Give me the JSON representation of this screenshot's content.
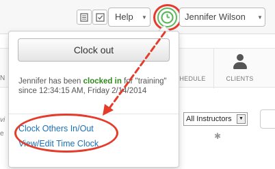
{
  "header": {
    "help_label": "Help",
    "user_name": "Jennifer Wilson"
  },
  "background": {
    "nav_items": [
      {
        "label": "HEDULE"
      },
      {
        "label": "CLIENTS"
      }
    ],
    "left_fragments": [
      "N",
      "vi",
      "e"
    ],
    "instructor_select_value": "All Instructors"
  },
  "dropdown": {
    "clock_out_label": "Clock out",
    "status": {
      "prefix": "Jennifer has been ",
      "highlight": "clocked in",
      "suffix": " for \"training\" since 12:34:15 AM, Friday 2/14/2014"
    },
    "links": [
      {
        "label": "Clock Others In/Out"
      },
      {
        "label": "View/Edit Time Clock"
      }
    ]
  },
  "colors": {
    "annotation_red": "#e53b2a",
    "clock_green": "#5cb85c",
    "link_blue": "#1a6fb8",
    "status_green": "#2f8a1c"
  }
}
